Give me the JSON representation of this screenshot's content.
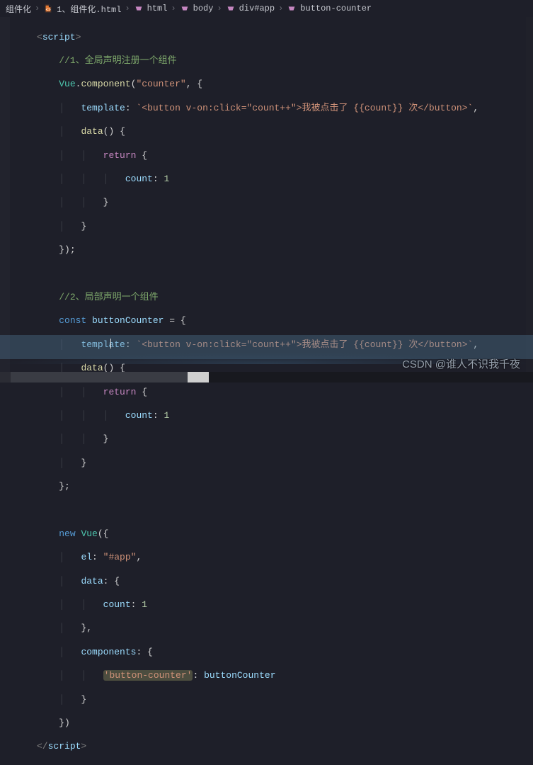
{
  "breadcrumbs": {
    "crumb1": "组件化",
    "crumb2": "1、组件化.html",
    "crumb3": "html",
    "crumb4": "body",
    "crumb5": "div#app",
    "crumb6": "button-counter"
  },
  "code": {
    "l1_open": "<",
    "l1_tag": "script",
    "l1_close": ">",
    "l2_cm": "//1、全局声明注册一个组件",
    "l3_a": "Vue",
    "l3_b": ".",
    "l3_c": "component",
    "l3_d": "(",
    "l3_e": "\"counter\"",
    "l3_f": ", {",
    "l4_a": "template",
    "l4_b": ": ",
    "l4_c": "`<button v-on:click=\"count++\">我被点击了 {{count}} 次</button>`",
    "l4_d": ",",
    "l5_a": "data",
    "l5_b": "()",
    "l5_c": " {",
    "l6_a": "return",
    "l6_b": " {",
    "l7_a": "count",
    "l7_b": ": ",
    "l7_c": "1",
    "l8": "}",
    "l9": "}",
    "l10": "});",
    "l12_cm": "//2、局部声明一个组件",
    "l13_a": "const",
    "l13_b": " ",
    "l13_c": "buttonCounter",
    "l13_d": " = {",
    "l14_a": "template",
    "l14_b": ": ",
    "l14_c": "`<button v-on:click=\"count++\">我被点击了 {{count}} 次</button>`",
    "l14_d": ",",
    "l15_a": "data",
    "l15_b": "()",
    "l15_c": " {",
    "l16_a": "return",
    "l16_b": " {",
    "l17_a": "count",
    "l17_b": ": ",
    "l17_c": "1",
    "l18": "}",
    "l19": "}",
    "l20": "};",
    "l22_a": "new",
    "l22_b": " ",
    "l22_c": "Vue",
    "l22_d": "({",
    "l23_a": "el",
    "l23_b": ": ",
    "l23_c": "\"#app\"",
    "l23_d": ",",
    "l24_a": "data",
    "l24_b": ": {",
    "l25_a": "count",
    "l25_b": ": ",
    "l25_c": "1",
    "l26": "},",
    "l27_a": "components",
    "l27_b": ": {",
    "l28_a": "'button-counter'",
    "l28_b": ": ",
    "l28_c": "buttonCounter",
    "l29": "}",
    "l30": "})",
    "l31_a": "</",
    "l31_b": "script",
    "l31_c": ">"
  },
  "watermark": "CSDN @谁人不识我千夜"
}
